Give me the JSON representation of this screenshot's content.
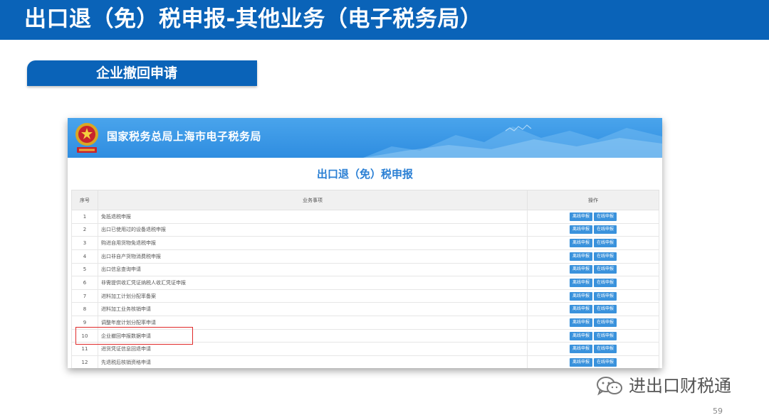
{
  "slide": {
    "title": "出口退（免）税申报-其他业务（电子税务局）",
    "section_tag": "企业撤回申请",
    "page_number": "59"
  },
  "portal": {
    "site_name": "国家税务总局上海市电子税务局",
    "page_heading": "出口退（免）税申报",
    "table": {
      "headers": [
        "序号",
        "业务事项",
        "操作"
      ],
      "button_labels": {
        "offline": "离线申报",
        "online": "在线申报"
      },
      "rows": [
        {
          "num": "1",
          "item": "免抵退税申报"
        },
        {
          "num": "2",
          "item": "出口已使用过的设备退税申报"
        },
        {
          "num": "3",
          "item": "购进自用货物免退税申报"
        },
        {
          "num": "4",
          "item": "出口非自产货物消费税申报"
        },
        {
          "num": "5",
          "item": "出口信息查询申请"
        },
        {
          "num": "6",
          "item": "非需提供收汇凭证纳税人收汇凭证申报"
        },
        {
          "num": "7",
          "item": "进料加工计划分配率备案"
        },
        {
          "num": "8",
          "item": "进料加工业务核销申请"
        },
        {
          "num": "9",
          "item": "调整年度计划分配率申请"
        },
        {
          "num": "10",
          "item": "企业撤回申报数据申请"
        },
        {
          "num": "11",
          "item": "进货凭证信息回退申请"
        },
        {
          "num": "12",
          "item": "先退税后核销资格申请"
        }
      ],
      "highlighted_row": "10"
    }
  },
  "watermark": {
    "text": "进出口财税通",
    "icon": "wechat-icon"
  },
  "colors": {
    "header_blue": "#0a63b8",
    "banner_blue": "#3a97e6",
    "heading_blue": "#2a7fd4",
    "button_blue": "#3a92dc",
    "highlight_red": "#e02a2a"
  }
}
